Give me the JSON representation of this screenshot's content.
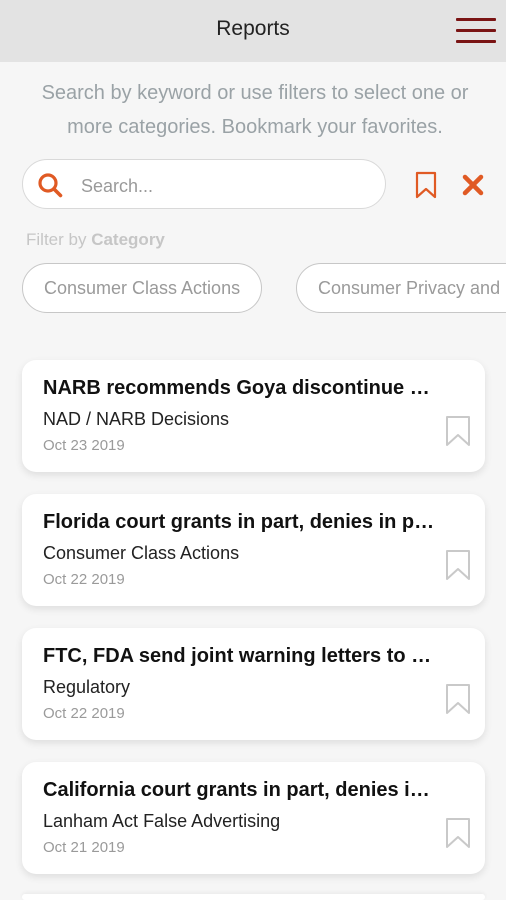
{
  "header": {
    "title": "Reports"
  },
  "intro_text": "Search by keyword or use filters to select one or more categories. Bookmark your favorites.",
  "search": {
    "placeholder": "Search...",
    "value": ""
  },
  "filter": {
    "label_prefix": "Filter by",
    "label_bold": "Category"
  },
  "chips": [
    {
      "label": "Consumer Class Actions"
    },
    {
      "label": "Consumer Privacy and Data Security"
    }
  ],
  "reports": [
    {
      "title": "NARB recommends Goya discontinue advertising claims",
      "category": "NAD / NARB Decisions",
      "date": "Oct 23 2019"
    },
    {
      "title": "Florida court grants in part, denies in part motion to dismiss",
      "category": "Consumer Class Actions",
      "date": "Oct 22 2019"
    },
    {
      "title": "FTC, FDA send joint warning letters to companies",
      "category": "Regulatory",
      "date": "Oct 22 2019"
    },
    {
      "title": "California court grants in part, denies in part motion",
      "category": "Lanham Act False Advertising",
      "date": "Oct 21 2019"
    }
  ],
  "colors": {
    "accent": "#e05a24",
    "brand": "#7a1414",
    "header_bg": "#e3e3e3"
  }
}
